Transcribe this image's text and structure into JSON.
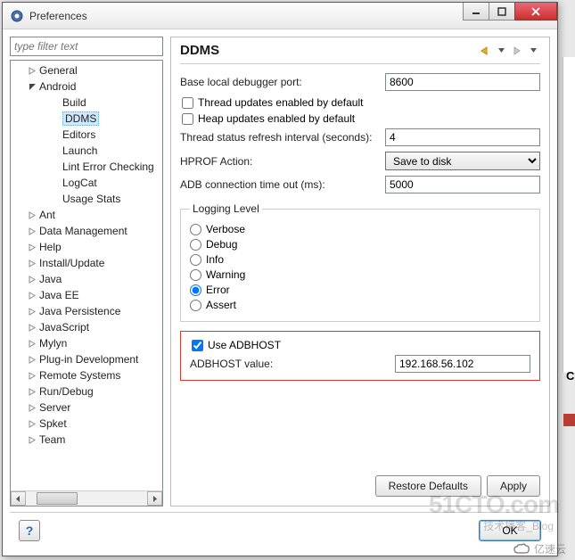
{
  "window": {
    "title": "Preferences"
  },
  "filter": {
    "placeholder": "type filter text"
  },
  "tree": [
    {
      "label": "General",
      "depth": 1,
      "expandable": true,
      "expanded": false
    },
    {
      "label": "Android",
      "depth": 1,
      "expandable": true,
      "expanded": true
    },
    {
      "label": "Build",
      "depth": 2
    },
    {
      "label": "DDMS",
      "depth": 2,
      "selected": true
    },
    {
      "label": "Editors",
      "depth": 2
    },
    {
      "label": "Launch",
      "depth": 2
    },
    {
      "label": "Lint Error Checking",
      "depth": 2
    },
    {
      "label": "LogCat",
      "depth": 2
    },
    {
      "label": "Usage Stats",
      "depth": 2
    },
    {
      "label": "Ant",
      "depth": 1,
      "expandable": true,
      "expanded": false
    },
    {
      "label": "Data Management",
      "depth": 1,
      "expandable": true,
      "expanded": false
    },
    {
      "label": "Help",
      "depth": 1,
      "expandable": true,
      "expanded": false
    },
    {
      "label": "Install/Update",
      "depth": 1,
      "expandable": true,
      "expanded": false
    },
    {
      "label": "Java",
      "depth": 1,
      "expandable": true,
      "expanded": false
    },
    {
      "label": "Java EE",
      "depth": 1,
      "expandable": true,
      "expanded": false
    },
    {
      "label": "Java Persistence",
      "depth": 1,
      "expandable": true,
      "expanded": false
    },
    {
      "label": "JavaScript",
      "depth": 1,
      "expandable": true,
      "expanded": false
    },
    {
      "label": "Mylyn",
      "depth": 1,
      "expandable": true,
      "expanded": false
    },
    {
      "label": "Plug-in Development",
      "depth": 1,
      "expandable": true,
      "expanded": false
    },
    {
      "label": "Remote Systems",
      "depth": 1,
      "expandable": true,
      "expanded": false
    },
    {
      "label": "Run/Debug",
      "depth": 1,
      "expandable": true,
      "expanded": false
    },
    {
      "label": "Server",
      "depth": 1,
      "expandable": true,
      "expanded": false
    },
    {
      "label": "Spket",
      "depth": 1,
      "expandable": true,
      "expanded": false
    },
    {
      "label": "Team",
      "depth": 1,
      "expandable": true,
      "expanded": false
    }
  ],
  "page": {
    "title": "DDMS",
    "base_port_label": "Base local debugger port:",
    "base_port_value": "8600",
    "thread_updates_label": "Thread updates enabled by default",
    "thread_updates_checked": false,
    "heap_updates_label": "Heap updates enabled by default",
    "heap_updates_checked": false,
    "refresh_label": "Thread status refresh interval (seconds):",
    "refresh_value": "4",
    "hprof_label": "HPROF Action:",
    "hprof_value": "Save to disk",
    "adb_timeout_label": "ADB connection time out (ms):",
    "adb_timeout_value": "5000",
    "logging_legend": "Logging Level",
    "logging_options": [
      "Verbose",
      "Debug",
      "Info",
      "Warning",
      "Error",
      "Assert"
    ],
    "logging_selected": "Error",
    "use_adbhost_label": "Use ADBHOST",
    "use_adbhost_checked": true,
    "adbhost_value_label": "ADBHOST value:",
    "adbhost_value": "192.168.56.102",
    "restore_label": "Restore Defaults",
    "apply_label": "Apply"
  },
  "footer": {
    "ok_label": "OK"
  },
  "watermark": {
    "w1": "51CTO.com",
    "w1sub": "技术播客_Blog",
    "w2": "亿速云"
  }
}
